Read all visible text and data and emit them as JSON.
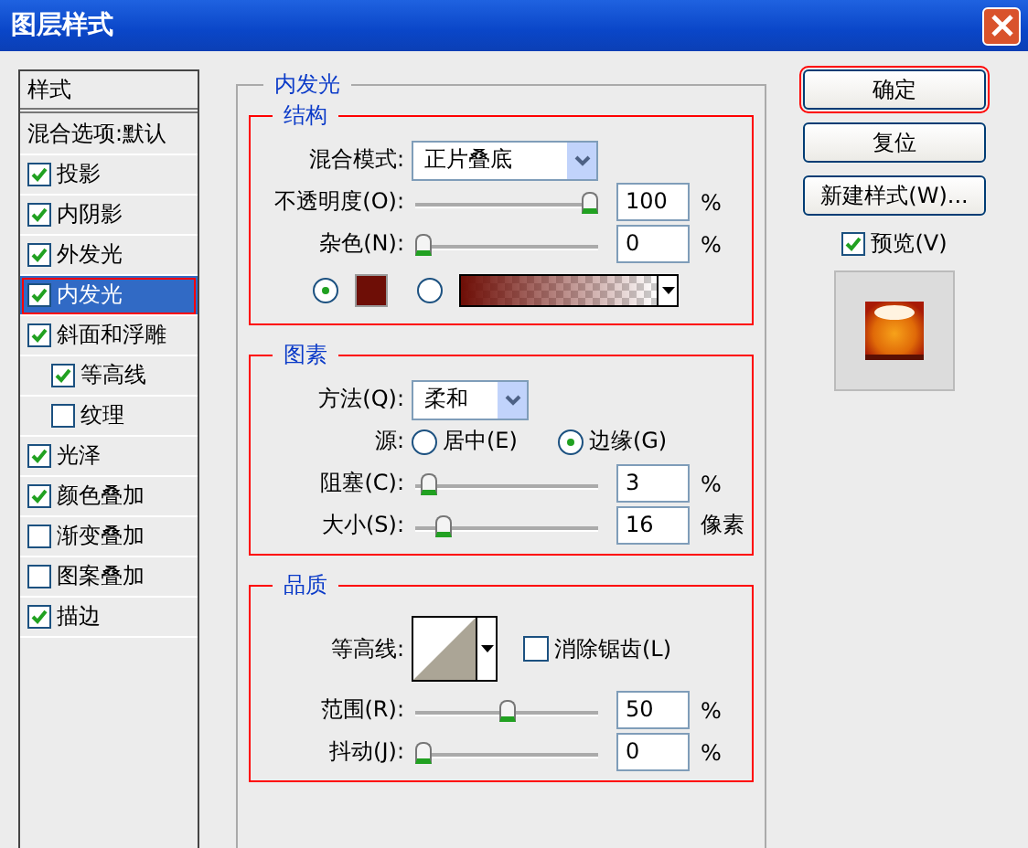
{
  "window": {
    "title": "图层样式"
  },
  "sidebar": {
    "header": "样式",
    "blend_options": "混合选项:默认",
    "items": [
      {
        "label": "投影",
        "checked": true,
        "selected": false,
        "highlighted": false
      },
      {
        "label": "内阴影",
        "checked": true,
        "selected": false,
        "highlighted": false
      },
      {
        "label": "外发光",
        "checked": true,
        "selected": false,
        "highlighted": false
      },
      {
        "label": "内发光",
        "checked": true,
        "selected": true,
        "highlighted": true
      },
      {
        "label": "斜面和浮雕",
        "checked": true,
        "selected": false,
        "highlighted": false,
        "children": [
          {
            "label": "等高线",
            "checked": true,
            "selected": false,
            "highlighted": false
          },
          {
            "label": "纹理",
            "checked": false,
            "selected": false,
            "highlighted": false
          }
        ]
      },
      {
        "label": "光泽",
        "checked": true,
        "selected": false,
        "highlighted": false
      },
      {
        "label": "颜色叠加",
        "checked": true,
        "selected": false,
        "highlighted": false
      },
      {
        "label": "渐变叠加",
        "checked": false,
        "selected": false,
        "highlighted": false
      },
      {
        "label": "图案叠加",
        "checked": false,
        "selected": false,
        "highlighted": false
      },
      {
        "label": "描边",
        "checked": true,
        "selected": false,
        "highlighted": false
      }
    ]
  },
  "panel": {
    "title": "内发光",
    "structure": {
      "title": "结构",
      "highlighted": true,
      "blend_mode": {
        "label": "混合模式:",
        "value": "正片叠底"
      },
      "sliders": [
        {
          "label": "不透明度(O):",
          "level": 1,
          "value": "100",
          "unit": "%"
        },
        {
          "label": "杂色(N):",
          "level": 0,
          "value": "0",
          "unit": "%"
        }
      ],
      "fills": [
        {
          "kind": "color",
          "selected": true,
          "color": "#6e0e06"
        },
        {
          "kind": "gradient",
          "selected": false,
          "color": "#6e0e06"
        }
      ]
    },
    "elements": {
      "title": "图素",
      "highlighted": true,
      "method": {
        "label": "方法(Q):",
        "value": "柔和"
      },
      "source": {
        "label": "源:",
        "options": [
          {
            "label": "居中(E)",
            "selected": false
          },
          {
            "label": "边缘(G)",
            "selected": true
          }
        ]
      },
      "sliders": [
        {
          "label": "阻塞(C):",
          "level": 0.03,
          "value": "3",
          "unit": "%"
        },
        {
          "label": "大小(S):",
          "level": 0.12,
          "value": "16",
          "unit": "像素"
        }
      ]
    },
    "quality": {
      "title": "品质",
      "highlighted": true,
      "contour": {
        "label": "等高线:"
      },
      "anti_alias": {
        "label": "消除锯齿(L)",
        "checked": false
      },
      "sliders": [
        {
          "label": "范围(R):",
          "level": 0.5,
          "value": "50",
          "unit": "%"
        },
        {
          "label": "抖动(J):",
          "level": 0,
          "value": "0",
          "unit": "%"
        }
      ]
    }
  },
  "buttons": [
    {
      "label": "确定",
      "highlighted": true
    },
    {
      "label": "复位",
      "highlighted": false
    },
    {
      "label": "新建样式(W)...",
      "highlighted": false
    }
  ],
  "preview": {
    "label": "预览(V)",
    "checked": true
  }
}
